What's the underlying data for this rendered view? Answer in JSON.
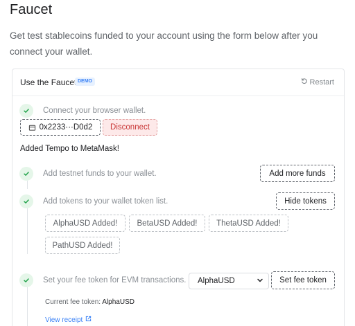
{
  "page": {
    "title": "Faucet",
    "description": "Get test stablecoins funded to your account using the form below after you connect your wallet."
  },
  "card": {
    "title": "Use the Faucet",
    "badge": "DEMO",
    "restart_label": "Restart"
  },
  "steps": {
    "connect": {
      "text": "Connect your browser wallet.",
      "address": "0x2233···D0d2",
      "disconnect_label": "Disconnect"
    },
    "info_message": "Added Tempo to MetaMask!",
    "funds": {
      "text": "Add testnet funds to your wallet.",
      "button_label": "Add more funds"
    },
    "tokens": {
      "text": "Add tokens to your wallet token list.",
      "button_label": "Hide tokens",
      "added": [
        "AlphaUSD Added!",
        "BetaUSD Added!",
        "ThetaUSD Added!",
        "PathUSD Added!"
      ]
    },
    "fee": {
      "text": "Set your fee token for EVM transactions.",
      "selected_token": "AlphaUSD",
      "button_label": "Set fee token",
      "current_label": "Current fee token: ",
      "current_value": "AlphaUSD",
      "receipt_label": "View receipt"
    }
  },
  "colors": {
    "accent": "#3b82f6",
    "success": "#22a34a",
    "danger": "#c93636"
  },
  "icons": [
    "restart-icon",
    "check-icon",
    "wallet-icon",
    "chevron-down-icon",
    "external-link-icon"
  ]
}
